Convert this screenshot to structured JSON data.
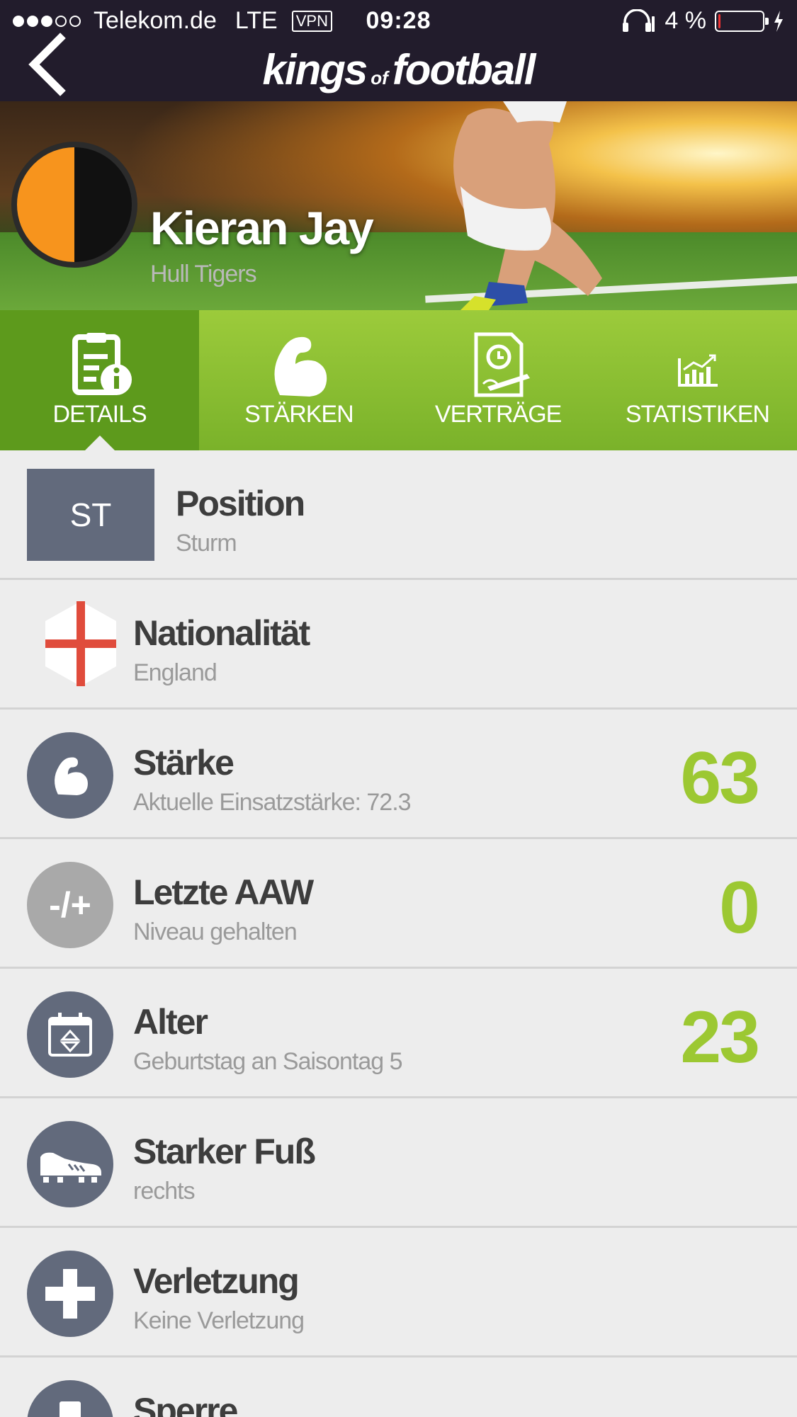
{
  "status": {
    "carrier": "Telekom.de",
    "network": "LTE",
    "vpn": "VPN",
    "time": "09:28",
    "battery": "4 %",
    "battery_level": 0.04
  },
  "nav": {
    "logo_main": "kings",
    "logo_of": "of",
    "logo_end": "football"
  },
  "player": {
    "name": "Kieran Jay",
    "club": "Hull Tigers",
    "club_colors": [
      "#f7941d",
      "#111111"
    ]
  },
  "tabs": [
    {
      "label": "DETAILS",
      "icon": "details-icon",
      "active": true
    },
    {
      "label": "STÄRKEN",
      "icon": "muscle-icon",
      "active": false
    },
    {
      "label": "VERTRÄGE",
      "icon": "contract-icon",
      "active": false
    },
    {
      "label": "STATISTIKEN",
      "icon": "stats-icon",
      "active": false
    }
  ],
  "details": {
    "position": {
      "badge": "ST",
      "title": "Position",
      "sub": "Sturm"
    },
    "nationality": {
      "title": "Nationalität",
      "sub": "England",
      "icon": "england-flag-icon"
    },
    "strength": {
      "title": "Stärke",
      "sub": "Aktuelle Einsatzstärke: 72.3",
      "value": "63",
      "icon": "muscle-icon"
    },
    "last_aaw": {
      "title": "Letzte AAW",
      "sub": "Niveau gehalten",
      "value": "0",
      "icon_text": "-/+"
    },
    "age": {
      "title": "Alter",
      "sub": "Geburtstag an Saisontag 5",
      "value": "23",
      "icon": "calendar-icon"
    },
    "foot": {
      "title": "Starker Fuß",
      "sub": "rechts",
      "icon": "boot-icon"
    },
    "injury": {
      "title": "Verletzung",
      "sub": "Keine Verletzung",
      "icon": "cross-icon"
    },
    "ban": {
      "title": "Sperre",
      "icon": "card-icon"
    }
  },
  "colors": {
    "accent_green": "#9cc832",
    "tab_active": "#5d9a1c",
    "icon_bg": "#626a7c",
    "navbar": "#221c2c"
  }
}
